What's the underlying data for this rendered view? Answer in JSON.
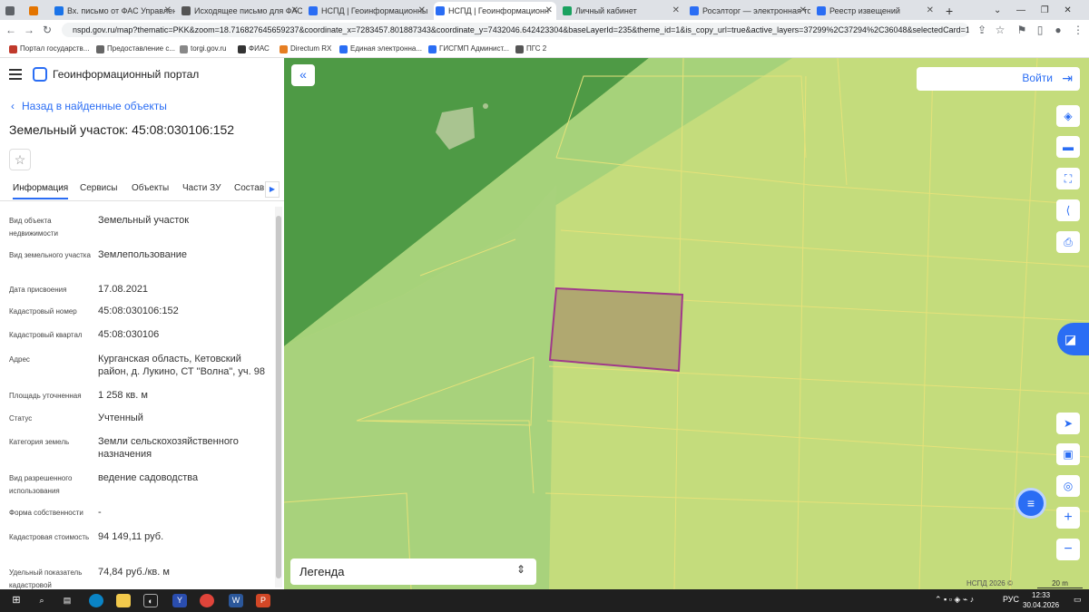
{
  "browser": {
    "tabs": [
      {
        "label": "Вх. письмо от ФАС Управлен",
        "color": "#1a73e8"
      },
      {
        "label": "Исходящее письмо для ФАС",
        "color": "#555555"
      },
      {
        "label": "НСПД | Геоинформационны",
        "color": "#2a6df4"
      },
      {
        "label": "НСПД | Геоинформационн",
        "color": "#2a6df4"
      },
      {
        "label": "Личный кабинет",
        "color": "#1aa260"
      },
      {
        "label": "Росэлторг — электронная то",
        "color": "#2a6df4"
      },
      {
        "label": "Реестр извещений",
        "color": "#2a6df4"
      }
    ],
    "url": "nspd.gov.ru/map?thematic=PKK&zoom=18.716827645659237&coordinate_x=7283457.801887343&coordinate_y=7432046.642423304&baseLayerId=235&theme_id=1&is_copy_url=true&active_layers=37299%2C37294%2C36048&selectedCard=11259...",
    "bookmarks": [
      "Портал государств...",
      "Предоставление с...",
      "torgi.gov.ru",
      "ФИАС",
      "Directum RX",
      "Единая электронна...",
      "ГИСГМП Админист...",
      "ПГС 2"
    ]
  },
  "app": {
    "title": "Геоинформационный портал",
    "back_label": "Назад в найденные объекты",
    "page_title": "Земельный участок: 45:08:030106:152",
    "tabs": [
      "Информация",
      "Сервисы",
      "Объекты",
      "Части ЗУ",
      "Состав"
    ],
    "rows": [
      {
        "label": "Вид объекта недвижимости",
        "value": "Земельный участок"
      },
      {
        "label": "Вид земельного участка",
        "value": "Землепользование"
      },
      {
        "label": "Дата присвоения",
        "value": "17.08.2021"
      },
      {
        "label": "Кадастровый номер",
        "value": "45:08:030106:152"
      },
      {
        "label": "Кадастровый квартал",
        "value": "45:08:030106"
      },
      {
        "label": "Адрес",
        "value": "Курганская область, Кетовский район, д. Лукино, СТ \"Волна\", уч. 98"
      },
      {
        "label": "Площадь уточненная",
        "value": "1 258 кв. м"
      },
      {
        "label": "Статус",
        "value": "Учтенный"
      },
      {
        "label": "Категория земель",
        "value": "Земли сельскохозяйственного назначения"
      },
      {
        "label": "Вид разрешенного использования",
        "value": "ведение садоводства"
      },
      {
        "label": "Форма собственности",
        "value": "-"
      },
      {
        "label": "Кадастровая стоимость",
        "value": "94 149,11 руб."
      },
      {
        "label": "Удельный показатель кадастровой",
        "value": "74,84 руб./кв. м"
      }
    ]
  },
  "map": {
    "login_label": "Войти",
    "legend_label": "Легенда",
    "copyright": "НСПД 2026 ©",
    "scale": "20 m",
    "selected_color": "#b0a870",
    "accent": "#2a6df4"
  },
  "taskbar": {
    "lang": "РУС",
    "time": "12:33",
    "date": "30.04.2026"
  }
}
